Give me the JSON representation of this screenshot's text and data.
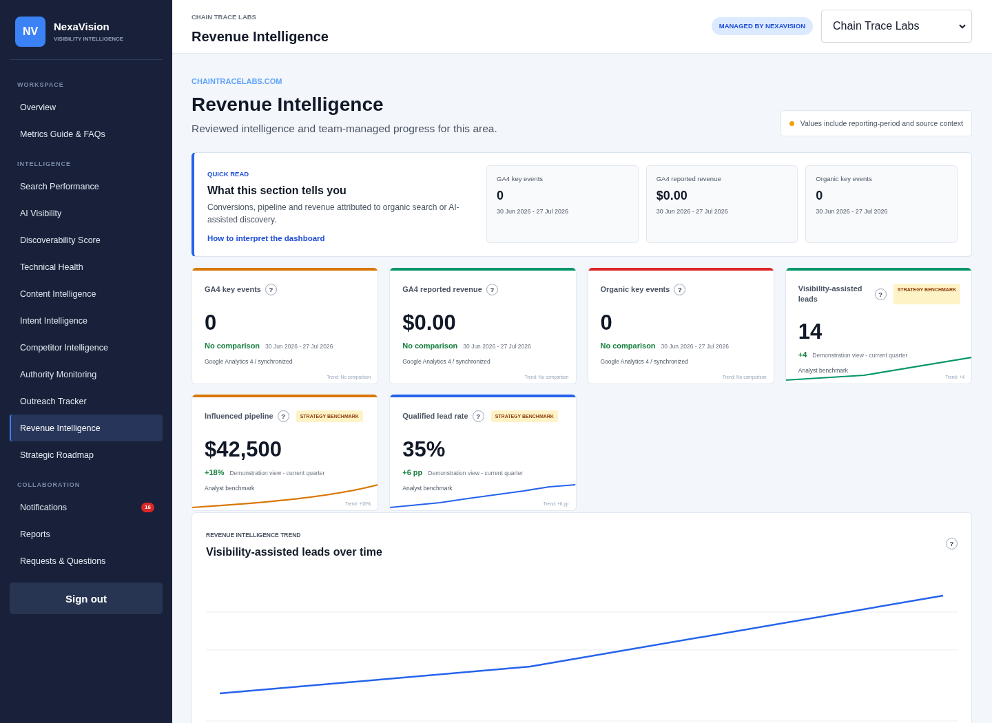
{
  "sidebar": {
    "brand": {
      "logo": "NV",
      "name": "NexaVision",
      "tagline": "VISIBILITY INTELLIGENCE"
    },
    "sections": [
      {
        "label": "WORKSPACE",
        "items": [
          {
            "label": "Overview",
            "selected": false
          },
          {
            "label": "Metrics Guide & FAQs",
            "selected": false
          }
        ]
      },
      {
        "label": "INTELLIGENCE",
        "items": [
          {
            "label": "Search Performance",
            "selected": false
          },
          {
            "label": "AI Visibility",
            "selected": false
          },
          {
            "label": "Discoverability Score",
            "selected": false
          },
          {
            "label": "Technical Health",
            "selected": false
          },
          {
            "label": "Content Intelligence",
            "selected": false
          },
          {
            "label": "Intent Intelligence",
            "selected": false
          },
          {
            "label": "Competitor Intelligence",
            "selected": false
          },
          {
            "label": "Authority Monitoring",
            "selected": false
          },
          {
            "label": "Outreach Tracker",
            "selected": false
          },
          {
            "label": "Revenue Intelligence",
            "selected": true
          },
          {
            "label": "Strategic Roadmap",
            "selected": false
          }
        ]
      },
      {
        "label": "COLLABORATION",
        "items": [
          {
            "label": "Notifications",
            "selected": false,
            "badge": "16"
          },
          {
            "label": "Reports",
            "selected": false
          },
          {
            "label": "Requests & Questions",
            "selected": false
          }
        ]
      }
    ],
    "sign_out": {
      "label": "Sign out"
    }
  },
  "header": {
    "breadcrumb": "CHAIN TRACE LABS",
    "title": "Revenue Intelligence",
    "badge": "MANAGED BY NEXAVISION",
    "client_select": {
      "value": "Chain Trace Labs"
    }
  },
  "intro": {
    "domain": "CHAINTRACELABS.COM",
    "title": "Revenue Intelligence",
    "subtitle": "Reviewed intelligence and team-managed progress for this area.",
    "note": "Values include reporting-period and source context"
  },
  "quick_read": {
    "eyebrow": "QUICK READ",
    "title": "What this section tells you",
    "description": "Conversions, pipeline and revenue attributed to organic search or AI-assisted discovery.",
    "link": "How to interpret the dashboard",
    "stats": [
      {
        "label": "GA4 key events",
        "value": "0",
        "period": "30 Jun 2026 - 27 Jul 2026"
      },
      {
        "label": "GA4 reported revenue",
        "value": "$0.00",
        "period": "30 Jun 2026 - 27 Jul 2026"
      },
      {
        "label": "Organic key events",
        "value": "0",
        "period": "30 Jun 2026 - 27 Jul 2026"
      }
    ]
  },
  "metrics": [
    {
      "kind": "synced",
      "title": "GA4 key events",
      "help": "?",
      "color": "#d97706",
      "value": "0",
      "change": "No comparison",
      "context": "30 Jun 2026 - 27 Jul 2026",
      "source": "Google Analytics 4 / synchronized",
      "trend": "Trend: No comparison"
    },
    {
      "kind": "synced",
      "title": "GA4 reported revenue",
      "help": "?",
      "color": "#059669",
      "value": "$0.00",
      "change": "No comparison",
      "context": "30 Jun 2026 - 27 Jul 2026",
      "source": "Google Analytics 4 / synchronized",
      "trend": "Trend: No comparison"
    },
    {
      "kind": "synced",
      "title": "Organic key events",
      "help": "?",
      "color": "#dc2626",
      "value": "0",
      "change": "No comparison",
      "context": "30 Jun 2026 - 27 Jul 2026",
      "source": "Google Analytics 4 / synchronized",
      "trend": "Trend: No comparison"
    },
    {
      "kind": "benchmark",
      "title": "Visibility-assisted leads",
      "help": "?",
      "badge": "STRATEGY BENCHMARK",
      "color": "#059669",
      "value": "14",
      "change": "+4",
      "context": "Demonstration view - current quarter",
      "source": "Analyst benchmark",
      "trend": "Trend: +4"
    },
    {
      "kind": "benchmark",
      "title": "Influenced pipeline",
      "help": "?",
      "badge": "STRATEGY BENCHMARK",
      "color": "#d97706",
      "value": "$42,500",
      "change": "+18%",
      "context": "Demonstration view - current quarter",
      "source": "Analyst benchmark",
      "trend": "Trend: +18%"
    },
    {
      "kind": "benchmark",
      "title": "Qualified lead rate",
      "help": "?",
      "badge": "STRATEGY BENCHMARK",
      "color": "#2563eb",
      "value": "35%",
      "change": "+6 pp",
      "context": "Demonstration view - current quarter",
      "source": "Analyst benchmark",
      "trend": "Trend: +6 pp"
    }
  ],
  "trend_chart": {
    "eyebrow": "REVENUE INTELLIGENCE TREND",
    "title": "Visibility-assisted leads over time",
    "help": "?"
  }
}
